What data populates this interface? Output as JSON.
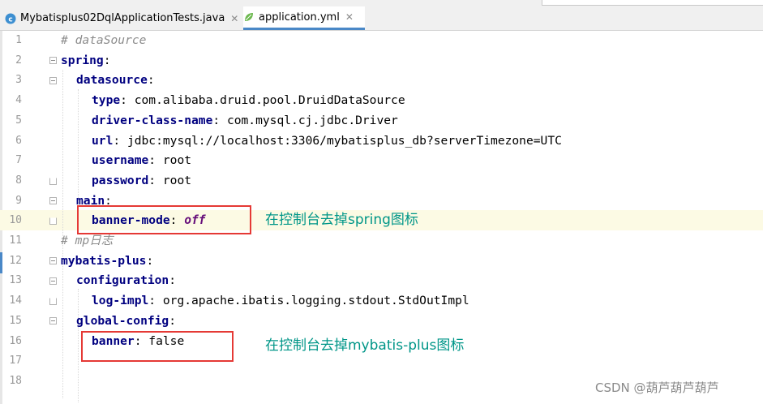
{
  "tabs": [
    {
      "label": "Mybatisplus02DqlApplicationTests.java",
      "icon": "java-class-icon",
      "active": false
    },
    {
      "label": "application.yml",
      "icon": "yaml-leaf-icon",
      "active": true
    }
  ],
  "lines": [
    {
      "num": "1",
      "comment": "# dataSource"
    },
    {
      "num": "2",
      "key": "spring",
      "sep": ":"
    },
    {
      "num": "3",
      "key": "datasource",
      "sep": ":"
    },
    {
      "num": "4",
      "key": "type",
      "sep": ": ",
      "value": "com.alibaba.druid.pool.DruidDataSource"
    },
    {
      "num": "5",
      "key": "driver-class-name",
      "sep": ": ",
      "value": "com.mysql.cj.jdbc.Driver"
    },
    {
      "num": "6",
      "key": "url",
      "sep": ": ",
      "value": "jdbc:mysql://localhost:3306/mybatisplus_db?serverTimezone=UTC"
    },
    {
      "num": "7",
      "key": "username",
      "sep": ": ",
      "value": "root"
    },
    {
      "num": "8",
      "key": "password",
      "sep": ": ",
      "value": "root"
    },
    {
      "num": "9",
      "key": "main",
      "sep": ":"
    },
    {
      "num": "10",
      "key": "banner-mode",
      "sep": ": ",
      "value": "off"
    },
    {
      "num": "11",
      "comment": "# mp日志"
    },
    {
      "num": "12",
      "key": "mybatis-plus",
      "sep": ":"
    },
    {
      "num": "13",
      "key": "configuration",
      "sep": ":"
    },
    {
      "num": "14",
      "key": "log-impl",
      "sep": ": ",
      "value": "org.apache.ibatis.logging.stdout.StdOutImpl"
    },
    {
      "num": "15",
      "key": "global-config",
      "sep": ":"
    },
    {
      "num": "16",
      "key": "banner",
      "sep": ": ",
      "value": "false"
    },
    {
      "num": "17"
    },
    {
      "num": "18"
    }
  ],
  "annotations": {
    "note1": "在控制台去掉spring图标",
    "note2": "在控制台去掉mybatis-plus图标"
  },
  "watermark": "CSDN @葫芦葫芦葫芦",
  "colors": {
    "key": "#000080",
    "comment": "#8c8c8c",
    "keyword_value": "#660e7a",
    "annotation_box": "#e53935",
    "annotation_text": "#009688",
    "current_line": "#fcfae4"
  }
}
